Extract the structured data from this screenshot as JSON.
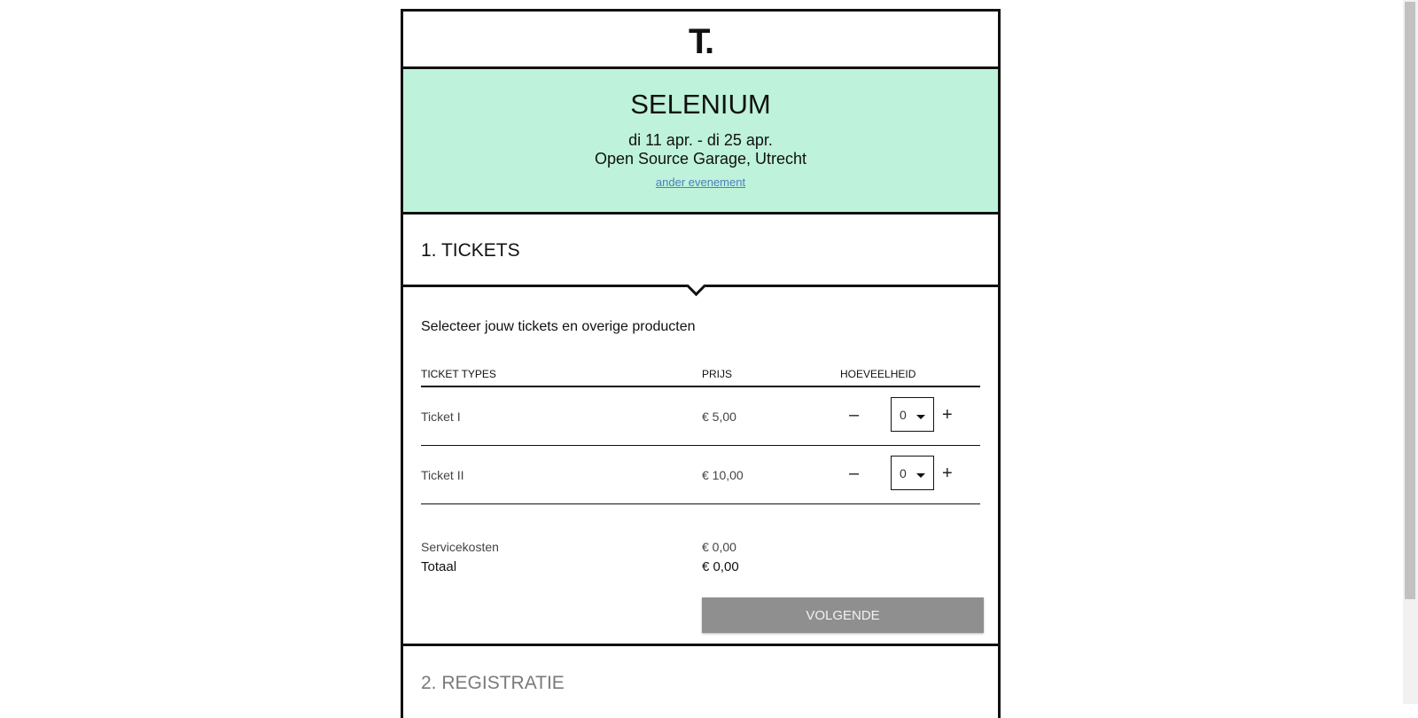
{
  "logo": "T.",
  "event": {
    "name": "SELENIUM",
    "dates": "di 11 apr. - di 25 apr.",
    "venue": "Open Source Garage, Utrecht",
    "other_link": "ander evenement"
  },
  "step1": {
    "title": "1. TICKETS",
    "intro": "Selecteer jouw tickets en overige producten",
    "columns": [
      "TICKET TYPES",
      "PRIJS",
      "HOEVEELHEID"
    ],
    "tickets": [
      {
        "name": "Ticket I",
        "price": "€ 5,00",
        "quantity": "0"
      },
      {
        "name": "Ticket II",
        "price": "€ 10,00",
        "quantity": "0"
      }
    ],
    "minus_label": "–",
    "plus_label": "+",
    "service_label": "Servicekosten",
    "service_value": "€ 0,00",
    "total_label": "Totaal",
    "total_value": "€ 0,00",
    "next_label": "VOLGENDE"
  },
  "step2": {
    "title": "2. REGISTRATIE"
  },
  "colors": {
    "event_bg": "#bef2da",
    "button_bg": "#8f8f8f",
    "link": "#4a7fbd"
  }
}
